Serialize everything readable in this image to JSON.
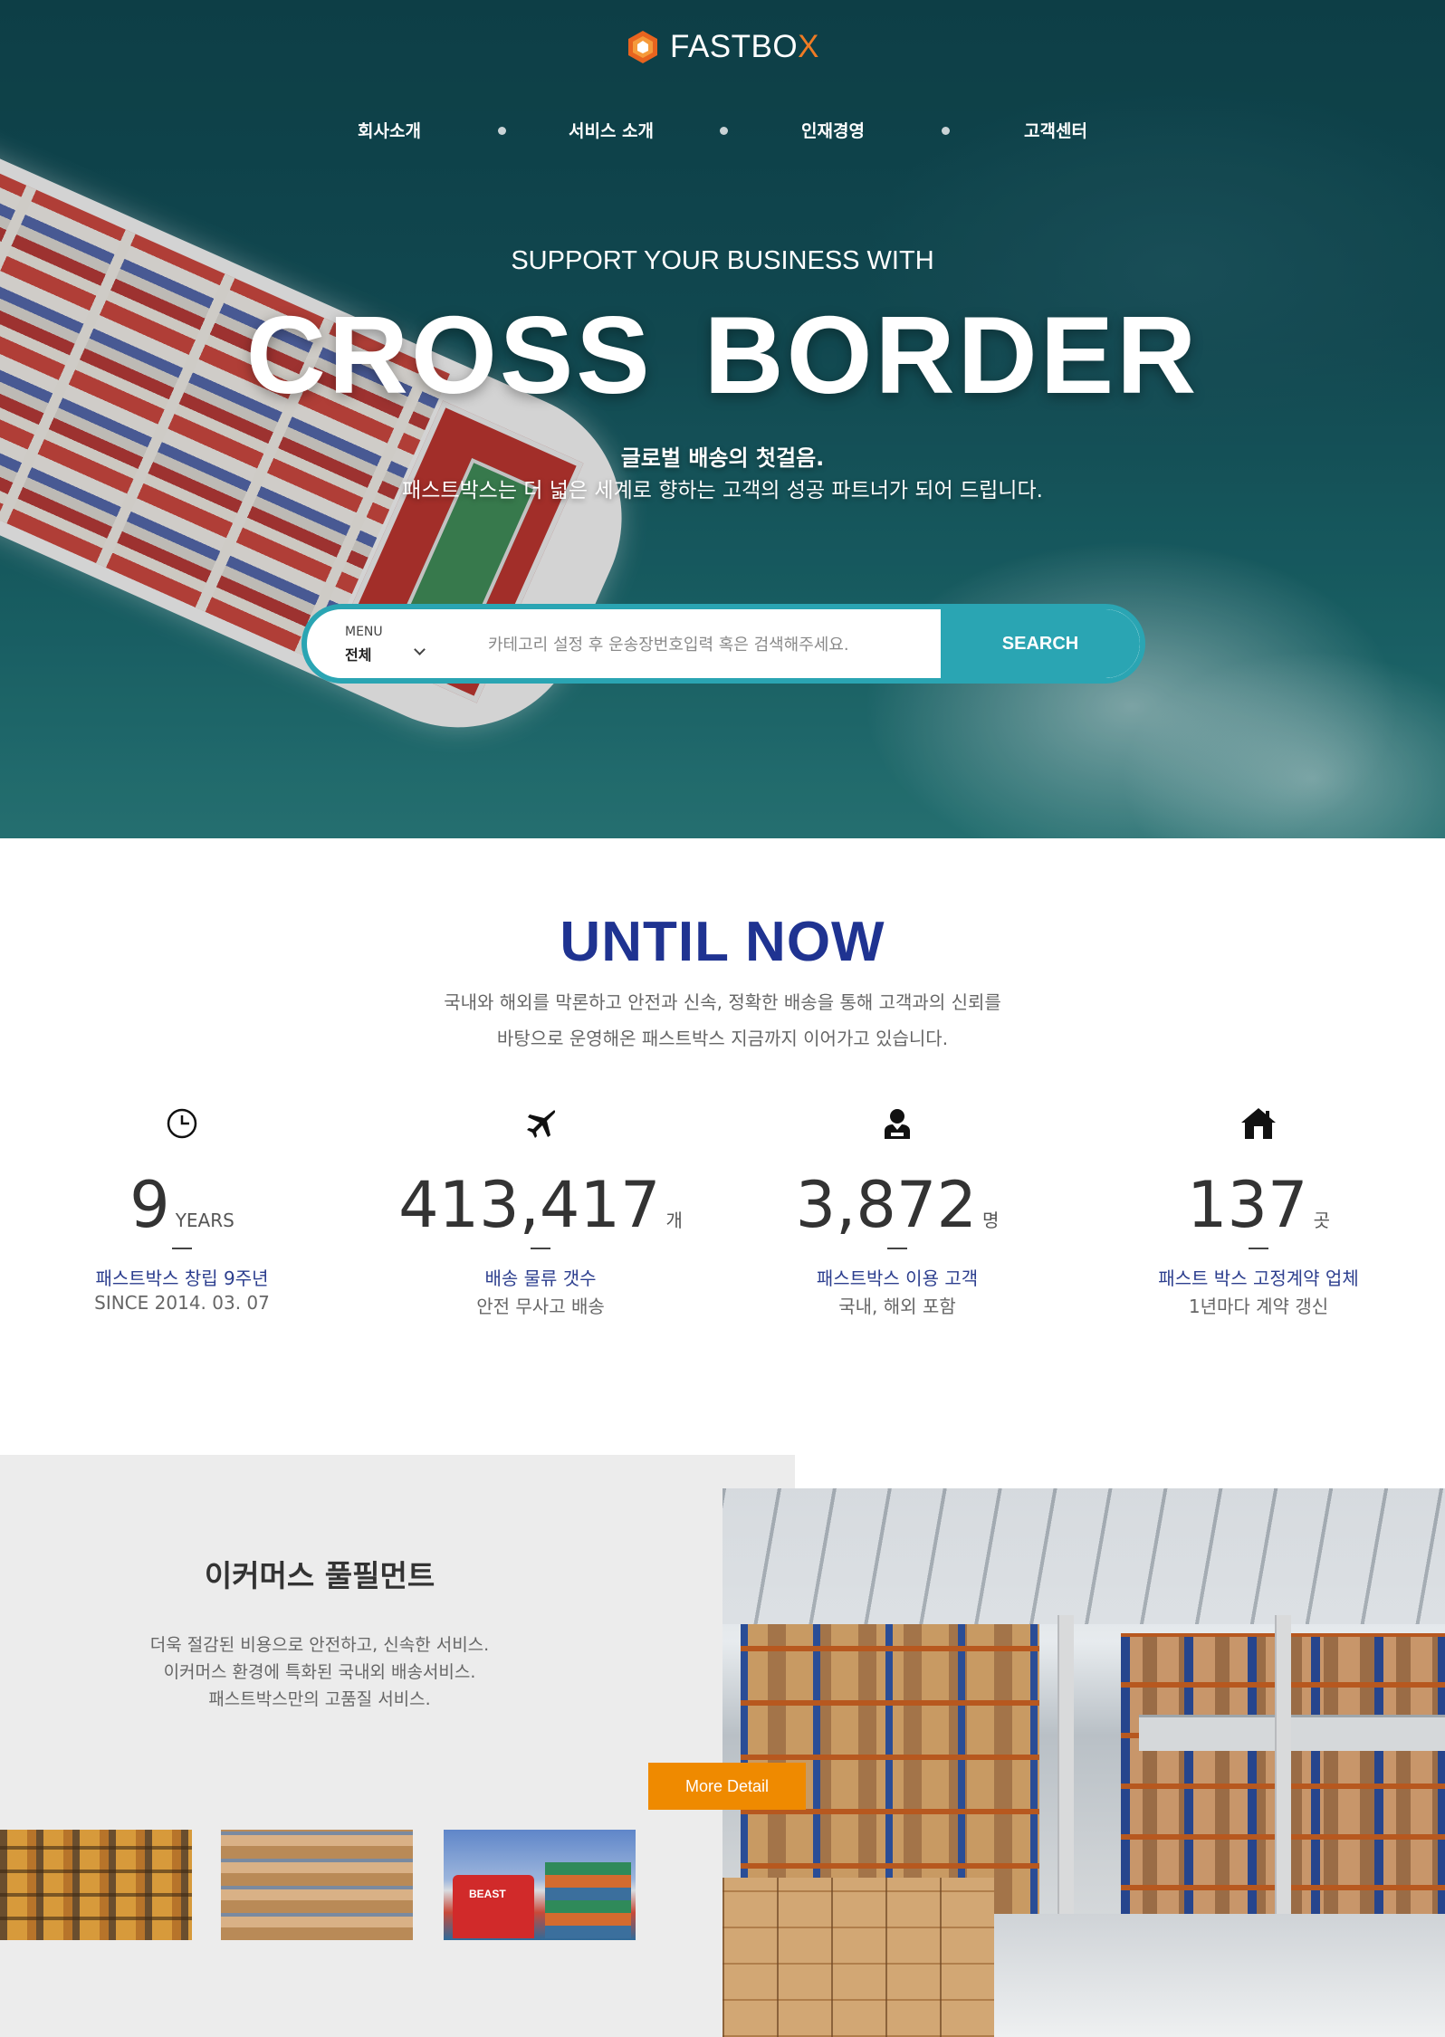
{
  "brand": {
    "name_main": "FASTBO",
    "name_accent": "X",
    "accent_color": "#ef7b24"
  },
  "nav": {
    "items": [
      "회사소개",
      "서비스 소개",
      "인재경영",
      "고객센터"
    ]
  },
  "hero": {
    "subtitle": "SUPPORT YOUR BUSINESS WITH",
    "title": "CROSS BORDER",
    "tagline1": "글로벌 배송의 첫걸음.",
    "tagline2": "패스트박스는 더 넓은 세계로 향하는 고객의 성공 파트너가 되어 드립니다."
  },
  "search": {
    "menu_label": "MENU",
    "category_value": "전체",
    "placeholder": "카테고리 설정 후 운송장번호입력 혹은 검색해주세요.",
    "button_label": "SEARCH",
    "accent_color": "#2aa5b3"
  },
  "until_now": {
    "title": "UNTIL NOW",
    "desc_line1": "국내와 해외를 막론하고 안전과 신속, 정확한 배송을 통해 고객과의 신뢰를",
    "desc_line2": "바탕으로 운영해온 패스트박스 지금까지 이어가고 있습니다.",
    "stats": [
      {
        "icon": "clock-icon",
        "number": "9",
        "unit": "YEARS",
        "label": "패스트박스 창립 9주년",
        "sub": "SINCE 2014. 03. 07"
      },
      {
        "icon": "airplane-icon",
        "number": "413,417",
        "unit": "개",
        "label": "배송 물류 갯수",
        "sub": "안전 무사고 배송"
      },
      {
        "icon": "person-icon",
        "number": "3,872",
        "unit": "명",
        "label": "패스트박스 이용 고객",
        "sub": "국내, 해외 포함"
      },
      {
        "icon": "house-icon",
        "number": "137",
        "unit": "곳",
        "label": "패스트 박스 고정계약 업체",
        "sub": "1년마다 계약 갱신"
      }
    ]
  },
  "fulfillment": {
    "title": "이커머스 풀필먼트",
    "desc_line1": "더욱 절감된 비용으로 안전하고, 신속한 서비스.",
    "desc_line2": "이커머스 환경에 특화된 국내외 배송서비스.",
    "desc_line3": "패스트박스만의 고품질 서비스.",
    "button_label": "More Detail",
    "button_color": "#ef8a00",
    "truck_label": "BEAST"
  }
}
